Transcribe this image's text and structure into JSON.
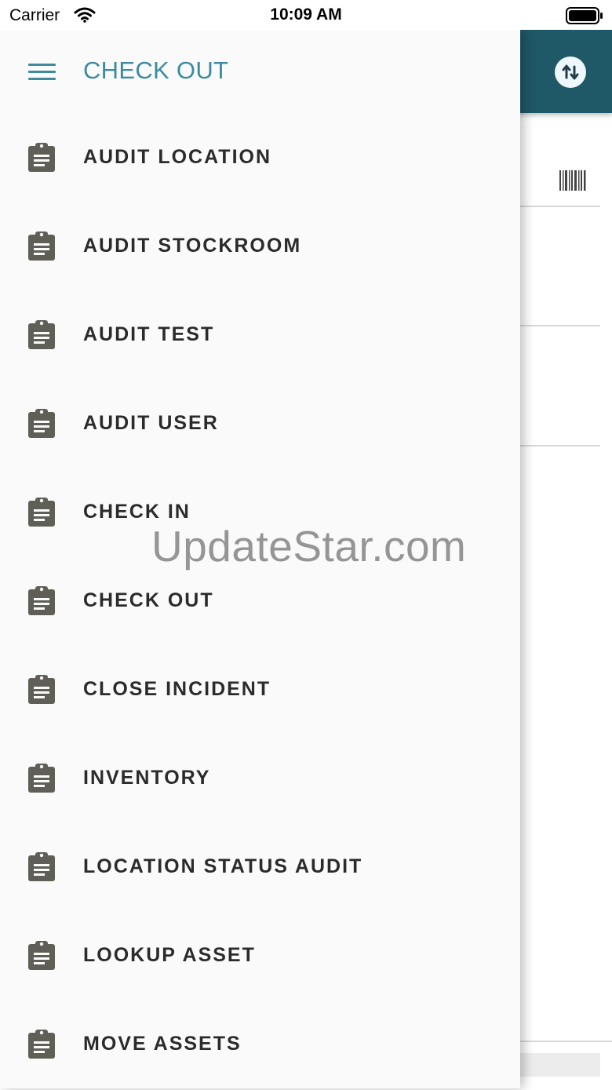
{
  "status_bar": {
    "carrier": "Carrier",
    "time": "10:09 AM"
  },
  "drawer": {
    "title": "CHECK OUT",
    "items": [
      {
        "label": "AUDIT LOCATION",
        "icon": "clipboard-icon"
      },
      {
        "label": "AUDIT STOCKROOM",
        "icon": "clipboard-icon"
      },
      {
        "label": "AUDIT TEST",
        "icon": "clipboard-icon"
      },
      {
        "label": "AUDIT USER",
        "icon": "clipboard-icon"
      },
      {
        "label": "CHECK IN",
        "icon": "clipboard-icon"
      },
      {
        "label": "CHECK OUT",
        "icon": "clipboard-icon"
      },
      {
        "label": "CLOSE INCIDENT",
        "icon": "clipboard-icon"
      },
      {
        "label": "INVENTORY",
        "icon": "clipboard-icon"
      },
      {
        "label": "LOCATION STATUS AUDIT",
        "icon": "clipboard-icon"
      },
      {
        "label": "LOOKUP ASSET",
        "icon": "clipboard-icon"
      },
      {
        "label": "MOVE ASSETS",
        "icon": "clipboard-icon"
      }
    ]
  },
  "background_app": {
    "header_color": "#1f5866",
    "accent_color": "#3e8ba1",
    "sync_icon": "sync-arrows-icon",
    "barcode_icon": "barcode-icon"
  },
  "watermark": "UpdateStar.com"
}
